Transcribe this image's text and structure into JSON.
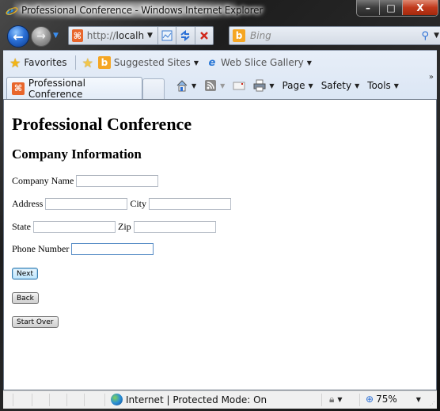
{
  "window": {
    "title": "Professional Conference - Windows Internet Explorer",
    "minimize_label": "–",
    "maximize_label": "□",
    "close_label": "X"
  },
  "nav": {
    "back_glyph": "←",
    "forward_glyph": "→",
    "address_scheme": "http://",
    "address_host": "localh...",
    "search_placeholder": "Bing",
    "icons": [
      "back-icon",
      "forward-icon",
      "recent-pages-icon",
      "site-favicon",
      "compatibility-view-icon",
      "refresh-icon",
      "stop-icon",
      "bing-icon",
      "search-icon"
    ]
  },
  "favorites_bar": {
    "favorites_label": "Favorites",
    "suggested_sites_label": "Suggested Sites",
    "web_slice_label": "Web Slice Gallery"
  },
  "tab": {
    "label": "Professional Conference"
  },
  "command_bar": {
    "page_label": "Page",
    "safety_label": "Safety",
    "tools_label": "Tools",
    "more_label": "»"
  },
  "page": {
    "heading": "Professional Conference",
    "subheading": "Company Information",
    "fields": {
      "company_name_label": "Company Name",
      "company_name_value": "",
      "address_label": "Address",
      "address_value": "",
      "city_label": "City",
      "city_value": "",
      "state_label": "State",
      "state_value": "",
      "zip_label": "Zip",
      "zip_value": "",
      "phone_label": "Phone Number",
      "phone_value": ""
    },
    "buttons": {
      "next": "Next",
      "back": "Back",
      "start_over": "Start Over"
    }
  },
  "status_bar": {
    "zone_text": "Internet | Protected Mode: On",
    "zoom_level": "75%"
  }
}
